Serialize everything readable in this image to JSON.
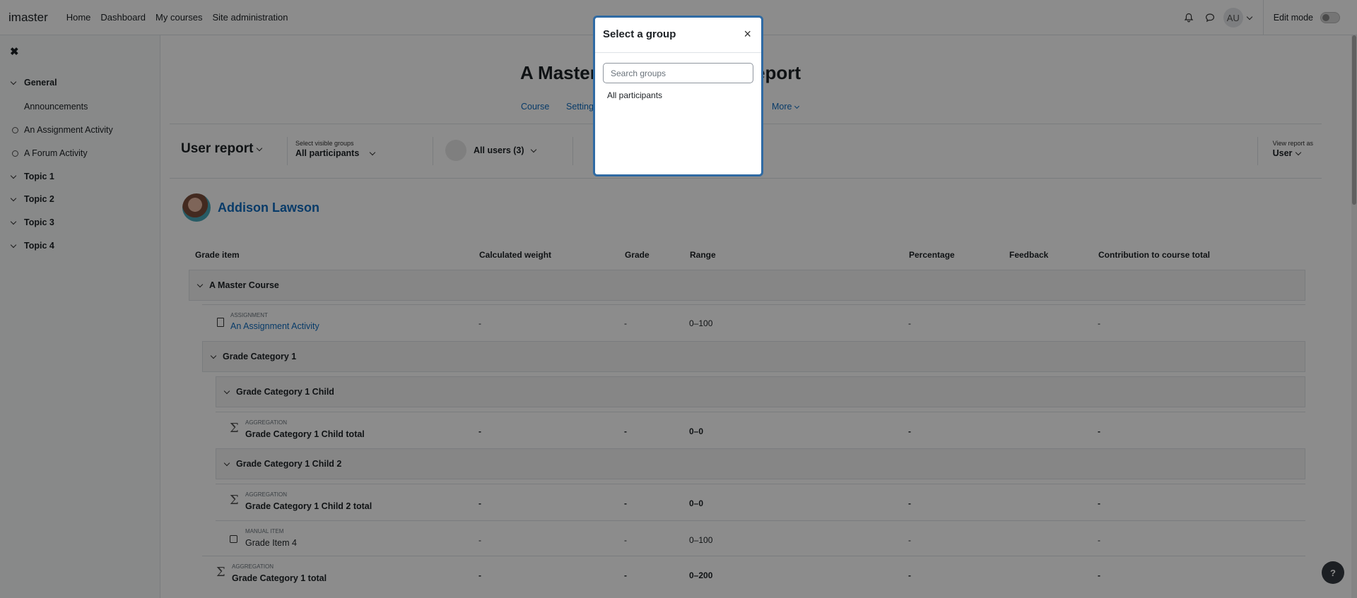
{
  "navbar": {
    "brand": "imaster",
    "links": [
      "Home",
      "Dashboard",
      "My courses",
      "Site administration"
    ],
    "avatar_initials": "AU",
    "edit_mode_label": "Edit mode"
  },
  "sidebar": {
    "sections": [
      {
        "label": "General"
      },
      {
        "label": "Topic 1"
      },
      {
        "label": "Topic 2"
      },
      {
        "label": "Topic 3"
      },
      {
        "label": "Topic 4"
      }
    ],
    "items": [
      {
        "label": "Announcements"
      },
      {
        "label": "An Assignment Activity"
      },
      {
        "label": "A Forum Activity"
      }
    ]
  },
  "course": {
    "title_left": "A Master",
    "title_right": "eport",
    "nav": [
      "Course",
      "Setting",
      "More"
    ]
  },
  "action_bar": {
    "report_label": "User report",
    "groups_small_label": "Select visible groups",
    "groups_value": "All participants",
    "users_label": "All users (3)",
    "view_as_small_label": "View report as",
    "view_as_value": "User"
  },
  "user": {
    "name": "Addison Lawson"
  },
  "table": {
    "headers": [
      "Grade item",
      "Calculated weight",
      "Grade",
      "Range",
      "Percentage",
      "Feedback",
      "Contribution to course total"
    ],
    "course_category": "A Master Course",
    "assignment": {
      "type": "ASSIGNMENT",
      "name": "An Assignment Activity",
      "weight": "-",
      "grade": "-",
      "range": "0–100",
      "percentage": "-",
      "contribution": "-"
    },
    "cat1": "Grade Category 1",
    "cat1_child": "Grade Category 1 Child",
    "cat1_child_total": {
      "type": "AGGREGATION",
      "name": "Grade Category 1 Child total",
      "weight": "-",
      "grade": "-",
      "range": "0–0",
      "percentage": "-",
      "contribution": "-"
    },
    "cat1_child2": "Grade Category 1 Child 2",
    "cat1_child2_total": {
      "type": "AGGREGATION",
      "name": "Grade Category 1 Child 2 total",
      "weight": "-",
      "grade": "-",
      "range": "0–0",
      "percentage": "-",
      "contribution": "-"
    },
    "grade_item4": {
      "type": "MANUAL ITEM",
      "name": "Grade Item 4",
      "weight": "-",
      "grade": "-",
      "range": "0–100",
      "percentage": "-",
      "contribution": "-"
    },
    "cat1_total": {
      "type": "AGGREGATION",
      "name": "Grade Category 1 total",
      "weight": "-",
      "grade": "-",
      "range": "0–200",
      "percentage": "-",
      "contribution": "-"
    }
  },
  "modal": {
    "title": "Select a group",
    "close_symbol": "×",
    "search_placeholder": "Search groups",
    "option": "All participants"
  },
  "help_symbol": "?"
}
